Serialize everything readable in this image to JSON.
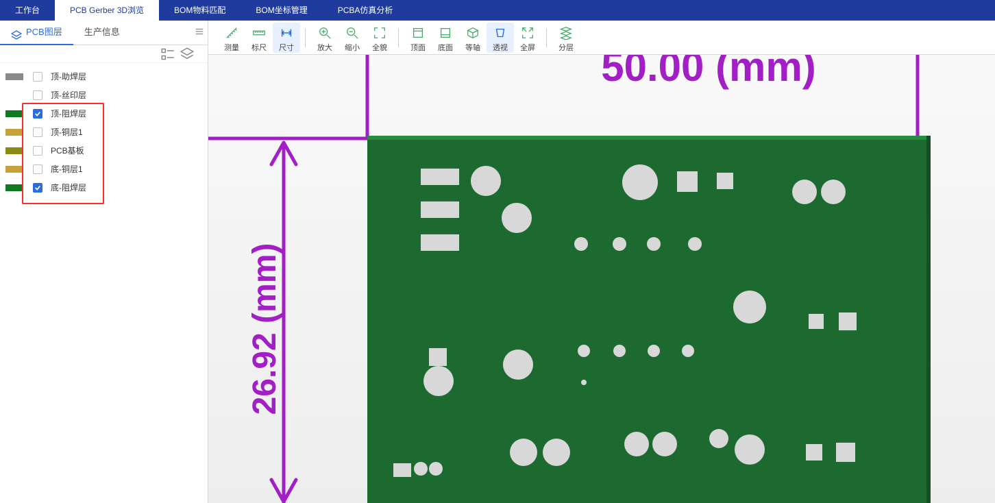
{
  "nav": {
    "tabs": [
      {
        "label": "工作台",
        "active": false
      },
      {
        "label": "PCB Gerber 3D浏览",
        "active": true
      },
      {
        "label": "BOM物料匹配",
        "active": false
      },
      {
        "label": "BOM坐标管理",
        "active": false
      },
      {
        "label": "PCBA仿真分析",
        "active": false
      }
    ]
  },
  "sidebar": {
    "tabs": [
      {
        "label": "PCB图层",
        "active": true,
        "icon": "layers-icon"
      },
      {
        "label": "生产信息",
        "active": false
      }
    ],
    "layers": [
      {
        "swatch": "#8a8a8a",
        "checked": false,
        "label": "顶-助焊层"
      },
      {
        "swatch": "#ffffff",
        "checked": false,
        "label": "顶-丝印层"
      },
      {
        "swatch": "#0f7a1f",
        "checked": true,
        "label": "顶-阻焊层"
      },
      {
        "swatch": "#c7a13a",
        "checked": false,
        "label": "顶-铜层1"
      },
      {
        "swatch": "#8a8a15",
        "checked": false,
        "label": "PCB基板"
      },
      {
        "swatch": "#c7a13a",
        "checked": false,
        "label": "底-铜层1"
      },
      {
        "swatch": "#0f7a1f",
        "checked": true,
        "label": "底-阻焊层"
      }
    ]
  },
  "toolbar": {
    "groups": [
      [
        {
          "icon": "measure-icon",
          "label": "测量"
        },
        {
          "icon": "ruler-icon",
          "label": "标尺"
        },
        {
          "icon": "dimension-icon",
          "label": "尺寸",
          "active": true
        }
      ],
      [
        {
          "icon": "zoom-in-icon",
          "label": "放大"
        },
        {
          "icon": "zoom-out-icon",
          "label": "缩小"
        },
        {
          "icon": "fit-icon",
          "label": "全貌"
        }
      ],
      [
        {
          "icon": "top-view-icon",
          "label": "顶面"
        },
        {
          "icon": "bottom-view-icon",
          "label": "底面"
        },
        {
          "icon": "iso-view-icon",
          "label": "等轴"
        },
        {
          "icon": "persp-view-icon",
          "label": "透视",
          "active": true
        },
        {
          "icon": "fullscreen-icon",
          "label": "全屏"
        }
      ],
      [
        {
          "icon": "explode-icon",
          "label": "分层"
        }
      ]
    ]
  },
  "viewport": {
    "dim_width_label": "50.00 (mm)",
    "dim_height_label": "26.92 (mm)",
    "accent_color": "#a11fc4",
    "pcb_color": "#1d6a30",
    "pad_color": "#d8d8d8"
  }
}
